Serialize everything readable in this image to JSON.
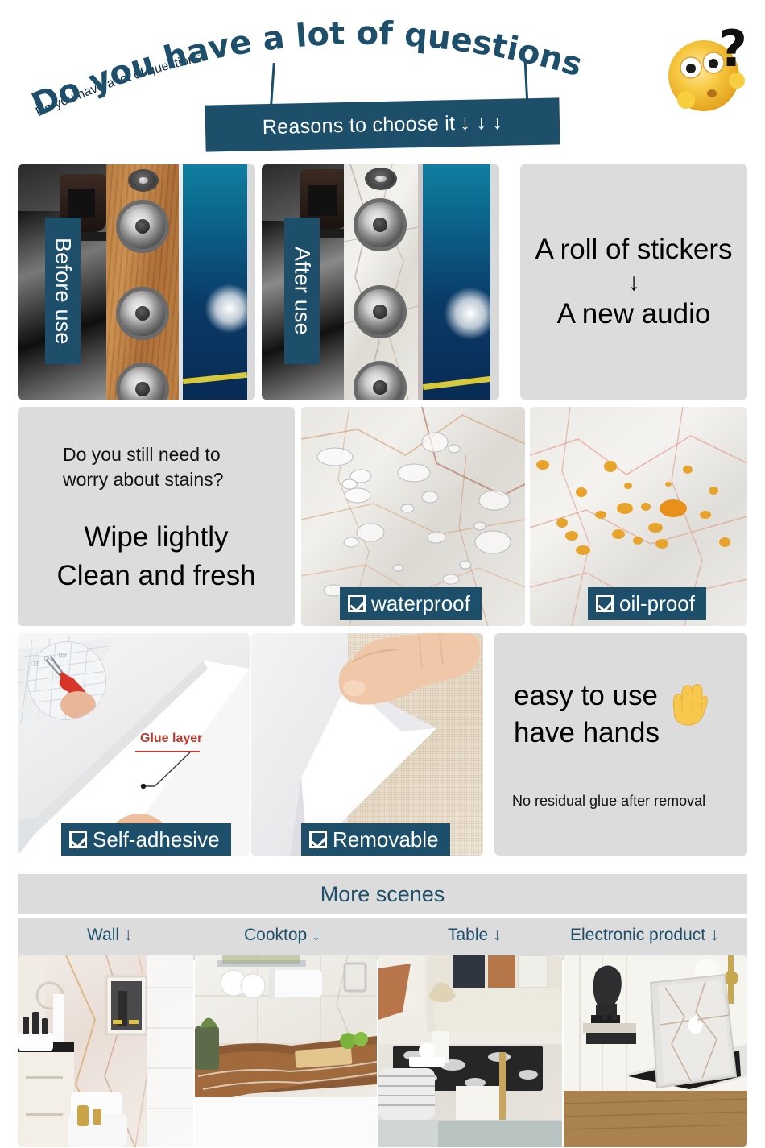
{
  "header": {
    "arched_title": "Do you have a lot of questions",
    "banner_text": "Reasons to choose it",
    "banner_arrows": "↓  ↓  ↓",
    "emoji_icon": "confused-face-emoji",
    "question_mark": "?"
  },
  "row1": {
    "before_tag": "Before use",
    "after_tag": "After use",
    "headline": "A roll of stickers",
    "arrow": "↓",
    "subline": "A new audio"
  },
  "row2": {
    "question_line1": "Do you still need to",
    "question_line2": "worry about stains?",
    "claim_line1": "Wipe lightly",
    "claim_line2": "Clean and fresh",
    "badge_waterproof": "waterproof",
    "badge_oilproof": "oil-proof"
  },
  "row3": {
    "glue_label": "Glue layer",
    "badge_self_adhesive": "Self-adhesive",
    "badge_removable": "Removable",
    "headline_line1": "easy to use",
    "headline_line2": "have hands",
    "hand_icon": "raised-hand-emoji",
    "note": "No residual glue after removal"
  },
  "more_scenes": {
    "title": "More scenes",
    "items": [
      {
        "label": "Wall",
        "arrow": "↓",
        "image": "bathroom-marble-wall"
      },
      {
        "label": "Cooktop",
        "arrow": "↓",
        "image": "kitchen-marble-countertop"
      },
      {
        "label": "Table",
        "arrow": "↓",
        "image": "living-room-marble-table"
      },
      {
        "label": "Electronic product",
        "arrow": "↓",
        "image": "marble-laptop-cover"
      }
    ]
  },
  "colors": {
    "accent": "#1d4f6b",
    "panel_grey": "#dcdcdc",
    "glue_red": "#c0392b",
    "page_bg": "#ffffff"
  }
}
